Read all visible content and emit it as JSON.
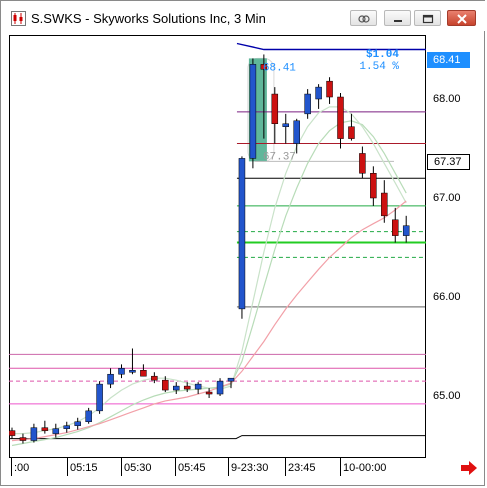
{
  "window": {
    "title": "S.SWKS - Skyworks Solutions Inc, 3 Min",
    "buttons": [
      "link-icon",
      "minimize-icon",
      "maximize-icon",
      "close-icon"
    ]
  },
  "price_axis": {
    "labels": [
      "68.00",
      "67.00",
      "66.00",
      "65.00"
    ],
    "tag_top": "68.41",
    "tag_current": "67.37"
  },
  "time_axis": {
    "labels": [
      ":00",
      "05:15",
      "05:30",
      "05:45",
      "9-23:30",
      "23:45",
      "10-00:00"
    ]
  },
  "annotation": {
    "change": "$1.04",
    "percent": "1.54 %",
    "box_high": "68.41",
    "box_low": "67.37"
  },
  "colors": {
    "up": "#2255cc",
    "down": "#cc1111",
    "highlight": "#44aa88",
    "blue_tag": "#1e8fff"
  },
  "chart_data": {
    "type": "candlestick",
    "ylim": [
      64.4,
      68.9
    ],
    "candles": [
      {
        "o": 64.65,
        "h": 64.68,
        "l": 64.57,
        "c": 64.6
      },
      {
        "o": 64.58,
        "h": 64.62,
        "l": 64.52,
        "c": 64.55
      },
      {
        "o": 64.55,
        "h": 64.72,
        "l": 64.53,
        "c": 64.68
      },
      {
        "o": 64.68,
        "h": 64.75,
        "l": 64.62,
        "c": 64.65
      },
      {
        "o": 64.62,
        "h": 64.72,
        "l": 64.58,
        "c": 64.67
      },
      {
        "o": 64.67,
        "h": 64.74,
        "l": 64.63,
        "c": 64.7
      },
      {
        "o": 64.7,
        "h": 64.78,
        "l": 64.66,
        "c": 64.74
      },
      {
        "o": 64.74,
        "h": 64.88,
        "l": 64.72,
        "c": 64.85
      },
      {
        "o": 64.85,
        "h": 65.15,
        "l": 64.82,
        "c": 65.12
      },
      {
        "o": 65.12,
        "h": 65.28,
        "l": 65.08,
        "c": 65.22
      },
      {
        "o": 65.22,
        "h": 65.32,
        "l": 65.18,
        "c": 65.28
      },
      {
        "o": 65.26,
        "h": 65.48,
        "l": 65.22,
        "c": 65.26
      },
      {
        "o": 65.26,
        "h": 65.32,
        "l": 65.2,
        "c": 65.2
      },
      {
        "o": 65.2,
        "h": 65.24,
        "l": 65.13,
        "c": 65.16
      },
      {
        "o": 65.16,
        "h": 65.2,
        "l": 65.04,
        "c": 65.06
      },
      {
        "o": 65.06,
        "h": 65.14,
        "l": 65.02,
        "c": 65.1
      },
      {
        "o": 65.1,
        "h": 65.14,
        "l": 65.04,
        "c": 65.07
      },
      {
        "o": 65.07,
        "h": 65.14,
        "l": 65.02,
        "c": 65.12
      },
      {
        "o": 65.04,
        "h": 65.08,
        "l": 64.98,
        "c": 65.02
      },
      {
        "o": 65.02,
        "h": 65.18,
        "l": 65.0,
        "c": 65.15
      },
      {
        "o": 65.15,
        "h": 65.18,
        "l": 65.08,
        "c": 65.18
      },
      {
        "o": 65.88,
        "h": 67.42,
        "l": 65.78,
        "c": 67.4
      },
      {
        "o": 67.4,
        "h": 68.41,
        "l": 67.3,
        "c": 68.35
      },
      {
        "o": 68.35,
        "h": 68.45,
        "l": 67.6,
        "c": 68.3
      },
      {
        "o": 68.05,
        "h": 68.12,
        "l": 67.55,
        "c": 67.75
      },
      {
        "o": 67.72,
        "h": 67.85,
        "l": 67.55,
        "c": 67.75
      },
      {
        "o": 67.55,
        "h": 67.8,
        "l": 67.45,
        "c": 67.78
      },
      {
        "o": 67.85,
        "h": 68.1,
        "l": 67.8,
        "c": 68.05
      },
      {
        "o": 68.0,
        "h": 68.15,
        "l": 67.9,
        "c": 68.12
      },
      {
        "o": 68.18,
        "h": 68.22,
        "l": 67.95,
        "c": 68.02
      },
      {
        "o": 68.02,
        "h": 68.06,
        "l": 67.5,
        "c": 67.6
      },
      {
        "o": 67.72,
        "h": 67.85,
        "l": 67.58,
        "c": 67.6
      },
      {
        "o": 67.45,
        "h": 67.52,
        "l": 67.2,
        "c": 67.25
      },
      {
        "o": 67.25,
        "h": 67.32,
        "l": 66.92,
        "c": 67.0
      },
      {
        "o": 67.05,
        "h": 67.18,
        "l": 66.75,
        "c": 66.82
      },
      {
        "o": 66.78,
        "h": 66.9,
        "l": 66.55,
        "c": 66.62
      },
      {
        "o": 66.62,
        "h": 66.82,
        "l": 66.55,
        "c": 66.72
      }
    ],
    "levels": [
      {
        "y": 68.5,
        "color": "#0000aa",
        "width": 1.4
      },
      {
        "y": 67.87,
        "color": "#7a1f80",
        "width": 1
      },
      {
        "y": 67.55,
        "color": "#aa1a2a",
        "width": 1
      },
      {
        "y": 67.2,
        "color": "#000000",
        "width": 1
      },
      {
        "y": 66.92,
        "color": "#22aa44",
        "width": 1
      },
      {
        "y": 66.66,
        "color": "#22aa44",
        "width": 1,
        "dash": true
      },
      {
        "y": 66.55,
        "color": "#22cc22",
        "width": 2
      },
      {
        "y": 66.4,
        "color": "#22aa44",
        "width": 1,
        "dash": true
      },
      {
        "y": 65.9,
        "color": "#000000",
        "width": 0.6
      },
      {
        "y": 65.42,
        "color": "#cc66aa",
        "width": 1
      },
      {
        "y": 65.28,
        "color": "#dd55aa",
        "width": 1
      },
      {
        "y": 65.15,
        "color": "#dd55aa",
        "width": 1,
        "dash": true
      },
      {
        "y": 64.92,
        "color": "#ee55cc",
        "width": 1
      },
      {
        "y": 64.6,
        "color": "#000000",
        "width": 1
      }
    ],
    "ma_pink": [
      64.55,
      64.56,
      64.57,
      64.59,
      64.61,
      64.63,
      64.66,
      64.69,
      64.72,
      64.76,
      64.8,
      64.84,
      64.88,
      64.92,
      64.95,
      64.97,
      64.99,
      65.02,
      65.05,
      65.09,
      65.13,
      65.25,
      65.4,
      65.55,
      65.72,
      65.88,
      66.02,
      66.15,
      66.28,
      66.4,
      66.5,
      66.6,
      66.68,
      66.74,
      66.8,
      66.88,
      66.97
    ],
    "ma_green1": [
      64.62,
      64.62,
      64.63,
      64.65,
      64.67,
      64.7,
      64.74,
      64.8,
      64.88,
      64.98,
      65.06,
      65.12,
      65.16,
      65.18,
      65.18,
      65.16,
      65.13,
      65.1,
      65.08,
      65.07,
      65.1,
      65.45,
      65.95,
      66.45,
      66.9,
      67.25,
      67.52,
      67.72,
      67.86,
      67.92,
      67.92,
      67.85,
      67.72,
      67.55,
      67.35,
      67.15,
      66.95
    ],
    "ma_green2": [
      64.5,
      64.52,
      64.54,
      64.56,
      64.58,
      64.61,
      64.64,
      64.68,
      64.73,
      64.79,
      64.85,
      64.91,
      64.96,
      65.0,
      65.03,
      65.05,
      65.06,
      65.07,
      65.08,
      65.09,
      65.12,
      65.35,
      65.72,
      66.1,
      66.48,
      66.82,
      67.1,
      67.35,
      67.55,
      67.68,
      67.76,
      67.78,
      67.74,
      67.62,
      67.45,
      67.25,
      67.05
    ]
  }
}
